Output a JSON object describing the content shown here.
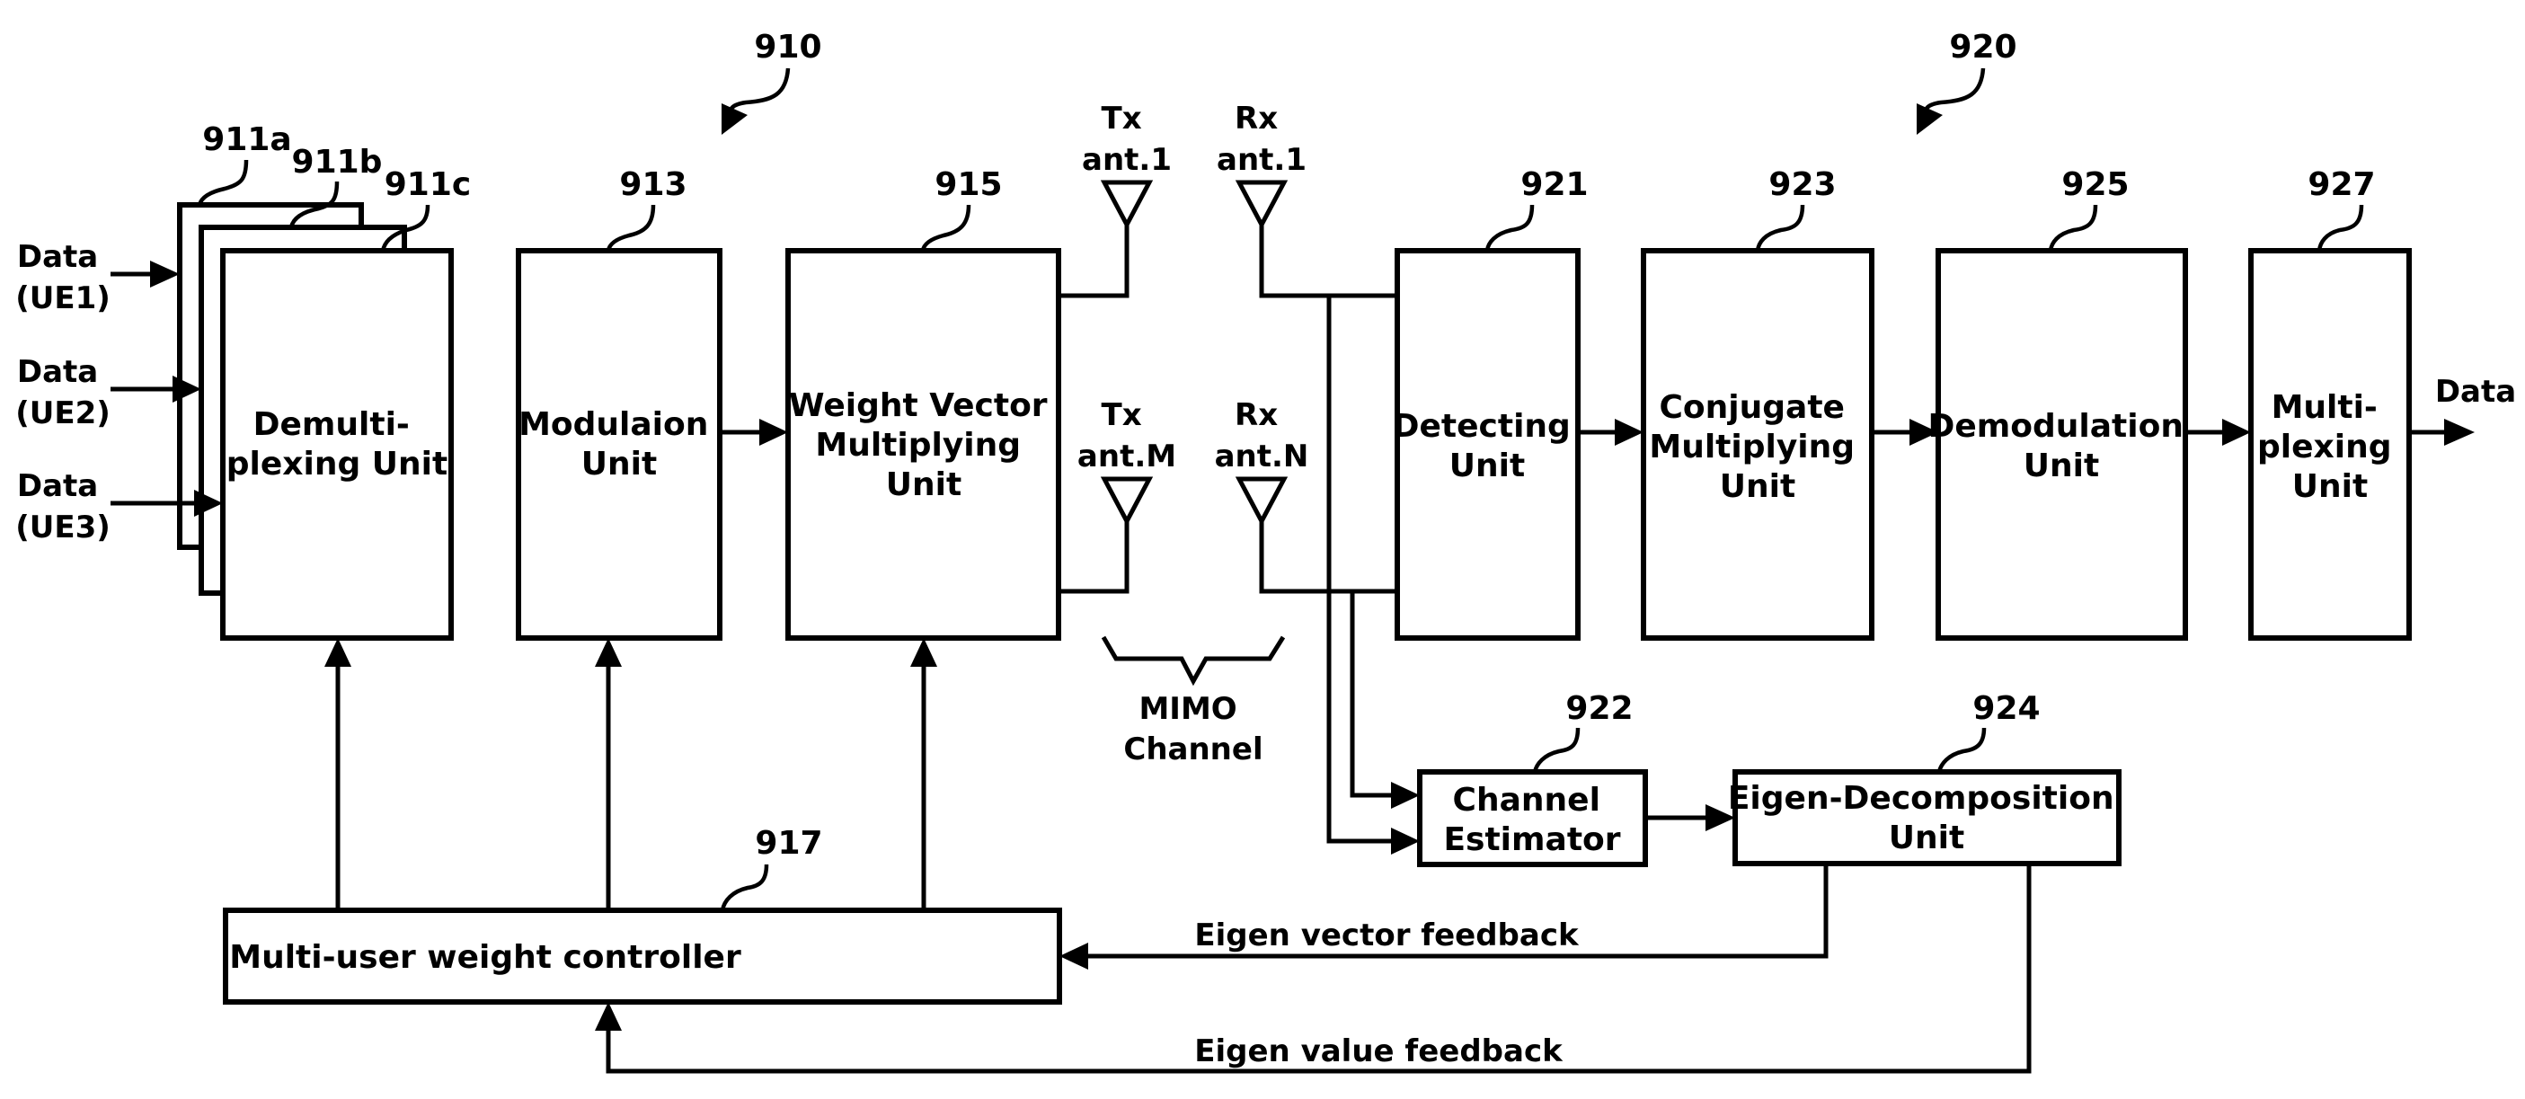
{
  "diagram": {
    "transmitter": {
      "ref": "910",
      "demux_stack": {
        "refs": [
          "911a",
          "911b",
          "911c"
        ],
        "label_lines": [
          "Demulti-",
          "plexing Unit"
        ],
        "inputs": [
          {
            "line1": "Data",
            "line2": "(UE1)"
          },
          {
            "line1": "Data",
            "line2": "(UE2)"
          },
          {
            "line1": "Data",
            "line2": "(UE3)"
          }
        ]
      },
      "modulation": {
        "ref": "913",
        "label_lines": [
          "Modulaion",
          "Unit"
        ]
      },
      "weight_vector": {
        "ref": "915",
        "label_lines": [
          "Weight Vector",
          "Multiplying",
          "Unit"
        ]
      },
      "controller": {
        "ref": "917",
        "label": "Multi-user weight controller"
      },
      "tx_antennas": [
        {
          "line1": "Tx",
          "line2": "ant.1"
        },
        {
          "line1": "Tx",
          "line2": "ant.M"
        }
      ]
    },
    "channel": {
      "label_lines": [
        "MIMO",
        "Channel"
      ]
    },
    "receiver": {
      "ref": "920",
      "rx_antennas": [
        {
          "line1": "Rx",
          "line2": "ant.1"
        },
        {
          "line1": "Rx",
          "line2": "ant.N"
        }
      ],
      "detecting": {
        "ref": "921",
        "label_lines": [
          "Detecting",
          "Unit"
        ]
      },
      "channel_estimator": {
        "ref": "922",
        "label_lines": [
          "Channel",
          "Estimator"
        ]
      },
      "conjugate": {
        "ref": "923",
        "label_lines": [
          "Conjugate",
          "Multiplying",
          "Unit"
        ]
      },
      "eigen": {
        "ref": "924",
        "label_lines": [
          "Eigen-Decomposition",
          "Unit"
        ]
      },
      "demodulation": {
        "ref": "925",
        "label_lines": [
          "Demodulation",
          "Unit"
        ]
      },
      "multiplexing": {
        "ref": "927",
        "label_lines": [
          "Multi-",
          "plexing",
          "Unit"
        ]
      },
      "output_label": "Data"
    },
    "feedback": {
      "vector": "Eigen vector feedback",
      "value": "Eigen value feedback"
    }
  }
}
